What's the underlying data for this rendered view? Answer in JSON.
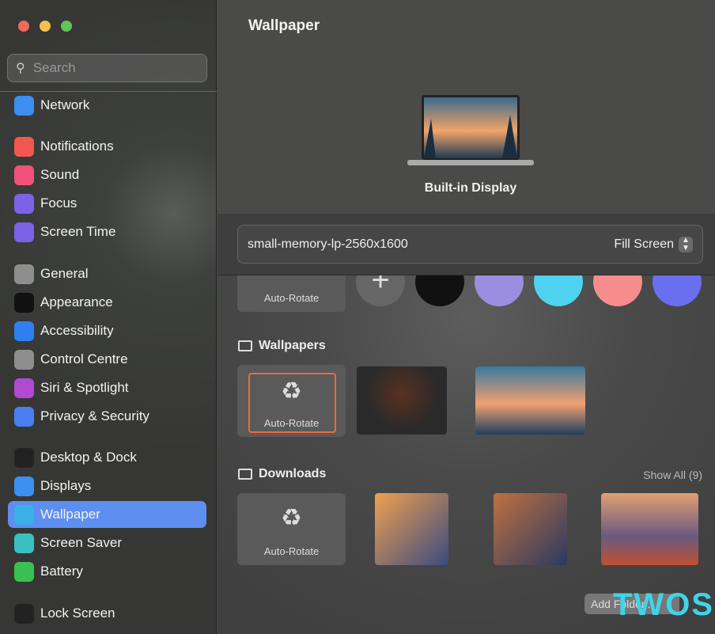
{
  "window": {
    "controls": [
      "close",
      "minimize",
      "zoom"
    ]
  },
  "sidebar": {
    "search_placeholder": "Search",
    "items": [
      {
        "label": "Network",
        "icon": "globe-icon",
        "color": "#3a8ff0"
      },
      {
        "label": "Notifications",
        "icon": "bell-icon",
        "color": "#f0584f"
      },
      {
        "label": "Sound",
        "icon": "speaker-icon",
        "color": "#f0527a"
      },
      {
        "label": "Focus",
        "icon": "moon-icon",
        "color": "#7b62e6"
      },
      {
        "label": "Screen Time",
        "icon": "hourglass-icon",
        "color": "#7b62e6"
      },
      {
        "label": "General",
        "icon": "gear-icon",
        "color": "#8e8e8e"
      },
      {
        "label": "Appearance",
        "icon": "appearance-icon",
        "color": "#111111"
      },
      {
        "label": "Accessibility",
        "icon": "accessibility-icon",
        "color": "#2f7ff0"
      },
      {
        "label": "Control Centre",
        "icon": "toggles-icon",
        "color": "#8e8e8e"
      },
      {
        "label": "Siri & Spotlight",
        "icon": "siri-icon",
        "color": "#b04ad0"
      },
      {
        "label": "Privacy & Security",
        "icon": "hand-icon",
        "color": "#4a7ef0"
      },
      {
        "label": "Desktop & Dock",
        "icon": "dock-icon",
        "color": "#222222"
      },
      {
        "label": "Displays",
        "icon": "sun-icon",
        "color": "#3a8ff0"
      },
      {
        "label": "Wallpaper",
        "icon": "wallpaper-icon",
        "color": "#3ab0e8",
        "selected": true
      },
      {
        "label": "Screen Saver",
        "icon": "screensaver-icon",
        "color": "#3ac0c0"
      },
      {
        "label": "Battery",
        "icon": "battery-icon",
        "color": "#3ac050"
      },
      {
        "label": "Lock Screen",
        "icon": "lock-icon",
        "color": "#222222"
      }
    ]
  },
  "main": {
    "title": "Wallpaper",
    "display_name": "Built-in Display",
    "wallpaper_name": "small-memory-lp-2560x1600",
    "fit_option": "Fill Screen",
    "colors_row": {
      "auto_rotate": "Auto-Rotate",
      "swatches": [
        "#111111",
        "#9b8ee0",
        "#4fd2ef",
        "#f68c8c",
        "#6a6ff0"
      ]
    },
    "wallpapers": {
      "title": "Wallpapers",
      "auto_rotate": "Auto-Rotate"
    },
    "downloads": {
      "title": "Downloads",
      "show_all": "Show All (9)",
      "auto_rotate": "Auto-Rotate"
    },
    "add_folder": "Add Folder..."
  },
  "watermark": "TWOS"
}
